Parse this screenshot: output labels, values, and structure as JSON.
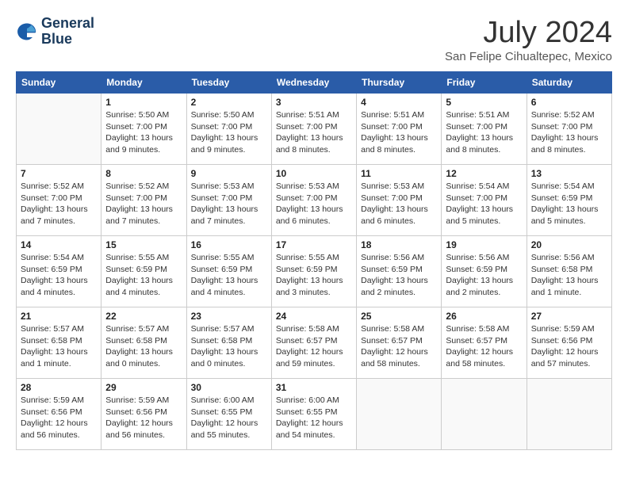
{
  "header": {
    "logo_line1": "General",
    "logo_line2": "Blue",
    "month_year": "July 2024",
    "location": "San Felipe Cihualtepec, Mexico"
  },
  "weekdays": [
    "Sunday",
    "Monday",
    "Tuesday",
    "Wednesday",
    "Thursday",
    "Friday",
    "Saturday"
  ],
  "weeks": [
    [
      {
        "day": "",
        "info": ""
      },
      {
        "day": "1",
        "info": "Sunrise: 5:50 AM\nSunset: 7:00 PM\nDaylight: 13 hours\nand 9 minutes."
      },
      {
        "day": "2",
        "info": "Sunrise: 5:50 AM\nSunset: 7:00 PM\nDaylight: 13 hours\nand 9 minutes."
      },
      {
        "day": "3",
        "info": "Sunrise: 5:51 AM\nSunset: 7:00 PM\nDaylight: 13 hours\nand 8 minutes."
      },
      {
        "day": "4",
        "info": "Sunrise: 5:51 AM\nSunset: 7:00 PM\nDaylight: 13 hours\nand 8 minutes."
      },
      {
        "day": "5",
        "info": "Sunrise: 5:51 AM\nSunset: 7:00 PM\nDaylight: 13 hours\nand 8 minutes."
      },
      {
        "day": "6",
        "info": "Sunrise: 5:52 AM\nSunset: 7:00 PM\nDaylight: 13 hours\nand 8 minutes."
      }
    ],
    [
      {
        "day": "7",
        "info": "Sunrise: 5:52 AM\nSunset: 7:00 PM\nDaylight: 13 hours\nand 7 minutes."
      },
      {
        "day": "8",
        "info": "Sunrise: 5:52 AM\nSunset: 7:00 PM\nDaylight: 13 hours\nand 7 minutes."
      },
      {
        "day": "9",
        "info": "Sunrise: 5:53 AM\nSunset: 7:00 PM\nDaylight: 13 hours\nand 7 minutes."
      },
      {
        "day": "10",
        "info": "Sunrise: 5:53 AM\nSunset: 7:00 PM\nDaylight: 13 hours\nand 6 minutes."
      },
      {
        "day": "11",
        "info": "Sunrise: 5:53 AM\nSunset: 7:00 PM\nDaylight: 13 hours\nand 6 minutes."
      },
      {
        "day": "12",
        "info": "Sunrise: 5:54 AM\nSunset: 7:00 PM\nDaylight: 13 hours\nand 5 minutes."
      },
      {
        "day": "13",
        "info": "Sunrise: 5:54 AM\nSunset: 6:59 PM\nDaylight: 13 hours\nand 5 minutes."
      }
    ],
    [
      {
        "day": "14",
        "info": "Sunrise: 5:54 AM\nSunset: 6:59 PM\nDaylight: 13 hours\nand 4 minutes."
      },
      {
        "day": "15",
        "info": "Sunrise: 5:55 AM\nSunset: 6:59 PM\nDaylight: 13 hours\nand 4 minutes."
      },
      {
        "day": "16",
        "info": "Sunrise: 5:55 AM\nSunset: 6:59 PM\nDaylight: 13 hours\nand 4 minutes."
      },
      {
        "day": "17",
        "info": "Sunrise: 5:55 AM\nSunset: 6:59 PM\nDaylight: 13 hours\nand 3 minutes."
      },
      {
        "day": "18",
        "info": "Sunrise: 5:56 AM\nSunset: 6:59 PM\nDaylight: 13 hours\nand 2 minutes."
      },
      {
        "day": "19",
        "info": "Sunrise: 5:56 AM\nSunset: 6:59 PM\nDaylight: 13 hours\nand 2 minutes."
      },
      {
        "day": "20",
        "info": "Sunrise: 5:56 AM\nSunset: 6:58 PM\nDaylight: 13 hours\nand 1 minute."
      }
    ],
    [
      {
        "day": "21",
        "info": "Sunrise: 5:57 AM\nSunset: 6:58 PM\nDaylight: 13 hours\nand 1 minute."
      },
      {
        "day": "22",
        "info": "Sunrise: 5:57 AM\nSunset: 6:58 PM\nDaylight: 13 hours\nand 0 minutes."
      },
      {
        "day": "23",
        "info": "Sunrise: 5:57 AM\nSunset: 6:58 PM\nDaylight: 13 hours\nand 0 minutes."
      },
      {
        "day": "24",
        "info": "Sunrise: 5:58 AM\nSunset: 6:57 PM\nDaylight: 12 hours\nand 59 minutes."
      },
      {
        "day": "25",
        "info": "Sunrise: 5:58 AM\nSunset: 6:57 PM\nDaylight: 12 hours\nand 58 minutes."
      },
      {
        "day": "26",
        "info": "Sunrise: 5:58 AM\nSunset: 6:57 PM\nDaylight: 12 hours\nand 58 minutes."
      },
      {
        "day": "27",
        "info": "Sunrise: 5:59 AM\nSunset: 6:56 PM\nDaylight: 12 hours\nand 57 minutes."
      }
    ],
    [
      {
        "day": "28",
        "info": "Sunrise: 5:59 AM\nSunset: 6:56 PM\nDaylight: 12 hours\nand 56 minutes."
      },
      {
        "day": "29",
        "info": "Sunrise: 5:59 AM\nSunset: 6:56 PM\nDaylight: 12 hours\nand 56 minutes."
      },
      {
        "day": "30",
        "info": "Sunrise: 6:00 AM\nSunset: 6:55 PM\nDaylight: 12 hours\nand 55 minutes."
      },
      {
        "day": "31",
        "info": "Sunrise: 6:00 AM\nSunset: 6:55 PM\nDaylight: 12 hours\nand 54 minutes."
      },
      {
        "day": "",
        "info": ""
      },
      {
        "day": "",
        "info": ""
      },
      {
        "day": "",
        "info": ""
      }
    ]
  ]
}
